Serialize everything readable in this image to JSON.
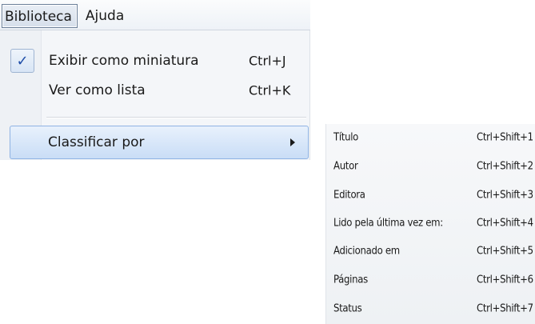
{
  "menubar": {
    "items": [
      {
        "label": "Biblioteca",
        "active": true
      },
      {
        "label": "Ajuda",
        "active": false
      }
    ]
  },
  "dropdown": {
    "items": [
      {
        "label": "Exibir como miniatura",
        "shortcut": "Ctrl+J",
        "checked": true
      },
      {
        "label": "Ver como lista",
        "shortcut": "Ctrl+K",
        "checked": false
      },
      {
        "label": "Classificar por",
        "has_submenu": true,
        "highlighted": true
      }
    ]
  },
  "submenu": {
    "items": [
      {
        "label": "Título",
        "shortcut": "Ctrl+Shift+1"
      },
      {
        "label": "Autor",
        "shortcut": "Ctrl+Shift+2"
      },
      {
        "label": "Editora",
        "shortcut": "Ctrl+Shift+3"
      },
      {
        "label": "Lido pela última vez em:",
        "shortcut": "Ctrl+Shift+4"
      },
      {
        "label": "Adicionado em",
        "shortcut": "Ctrl+Shift+5"
      },
      {
        "label": "Páginas",
        "shortcut": "Ctrl+Shift+6"
      },
      {
        "label": "Status",
        "shortcut": "Ctrl+Shift+7"
      }
    ]
  },
  "icons": {
    "checkmark": "check-icon",
    "submenu_arrow": "chevron-right-icon"
  },
  "colors": {
    "highlight": "#c9ddf6",
    "highlight_border": "#8fb3e3",
    "check": "#1f4ea8"
  }
}
